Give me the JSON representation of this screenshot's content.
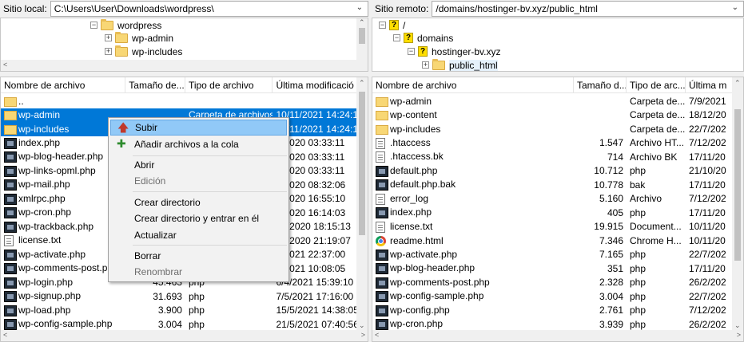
{
  "local": {
    "site_label": "Sitio local:",
    "path": "C:\\Users\\User\\Downloads\\wordpress\\",
    "tree": [
      "wordpress",
      "wp-admin",
      "wp-includes"
    ],
    "columns": [
      "Nombre de archivo",
      "Tamaño de...",
      "Tipo de archivo",
      "Última modificació"
    ],
    "files": [
      {
        "name": "..",
        "icon": "folder-icon",
        "size": "",
        "type": "",
        "mod": ""
      },
      {
        "name": "wp-admin",
        "icon": "folder-icon",
        "size": "",
        "type": "Carpeta de archivos",
        "mod": "10/11/2021 14:24:12",
        "selected": true
      },
      {
        "name": "wp-includes",
        "icon": "folder-icon",
        "size": "",
        "type": "Carpeta de archivos",
        "mod": "10/11/2021 14:24:13",
        "selected": true
      },
      {
        "name": "index.php",
        "icon": "php-icon",
        "size": "",
        "type": "",
        "mod": "2/2020 03:33:11"
      },
      {
        "name": "wp-blog-header.php",
        "icon": "php-icon",
        "size": "",
        "type": "",
        "mod": "2/2020 03:33:11"
      },
      {
        "name": "wp-links-opml.php",
        "icon": "php-icon",
        "size": "",
        "type": "",
        "mod": "2/2020 03:33:11"
      },
      {
        "name": "wp-mail.php",
        "icon": "php-icon",
        "size": "",
        "type": "",
        "mod": "4/2020 08:32:06"
      },
      {
        "name": "xmlrpc.php",
        "icon": "php-icon",
        "size": "",
        "type": "",
        "mod": "6/2020 16:55:10"
      },
      {
        "name": "wp-cron.php",
        "icon": "php-icon",
        "size": "",
        "type": "",
        "mod": "7/2020 16:14:03"
      },
      {
        "name": "wp-trackback.php",
        "icon": "php-icon",
        "size": "",
        "type": "",
        "mod": "10/2020 18:15:13"
      },
      {
        "name": "license.txt",
        "icon": "document-icon",
        "size": "",
        "type": "",
        "mod": "12/2020 21:19:07"
      },
      {
        "name": "wp-activate.php",
        "icon": "php-icon",
        "size": "",
        "type": "",
        "mod": "1/2021 22:37:00"
      },
      {
        "name": "wp-comments-post.php",
        "icon": "php-icon",
        "size": "",
        "type": "",
        "mod": "2/2021 10:08:05"
      },
      {
        "name": "wp-login.php",
        "icon": "php-icon",
        "size": "45.463",
        "type": "php",
        "mod": "6/4/2021 15:39:10"
      },
      {
        "name": "wp-signup.php",
        "icon": "php-icon",
        "size": "31.693",
        "type": "php",
        "mod": "7/5/2021 17:16:00"
      },
      {
        "name": "wp-load.php",
        "icon": "php-icon",
        "size": "3.900",
        "type": "php",
        "mod": "15/5/2021 14:38:05"
      },
      {
        "name": "wp-config-sample.php",
        "icon": "php-icon",
        "size": "3.004",
        "type": "php",
        "mod": "21/5/2021 07:40:56"
      }
    ]
  },
  "remote": {
    "site_label": "Sitio remoto:",
    "path": "/domains/hostinger-bv.xyz/public_html",
    "tree": [
      "/",
      "domains",
      "hostinger-bv.xyz",
      "public_html"
    ],
    "columns": [
      "Nombre de archivo",
      "Tamaño d...",
      "Tipo de arc...",
      "Última m"
    ],
    "files": [
      {
        "name": "wp-admin",
        "icon": "folder-icon",
        "size": "",
        "type": "Carpeta de...",
        "mod": "7/9/2021"
      },
      {
        "name": "wp-content",
        "icon": "folder-icon",
        "size": "",
        "type": "Carpeta de...",
        "mod": "18/12/20"
      },
      {
        "name": "wp-includes",
        "icon": "folder-icon",
        "size": "",
        "type": "Carpeta de...",
        "mod": "22/7/202"
      },
      {
        "name": ".htaccess",
        "icon": "document-icon",
        "size": "1.547",
        "type": "Archivo HT...",
        "mod": "7/12/202"
      },
      {
        "name": ".htaccess.bk",
        "icon": "document-icon",
        "size": "714",
        "type": "Archivo BK",
        "mod": "17/11/20"
      },
      {
        "name": "default.php",
        "icon": "php-icon",
        "size": "10.712",
        "type": "php",
        "mod": "21/10/20"
      },
      {
        "name": "default.php.bak",
        "icon": "php-icon",
        "size": "10.778",
        "type": "bak",
        "mod": "17/11/20"
      },
      {
        "name": "error_log",
        "icon": "document-icon",
        "size": "5.160",
        "type": "Archivo",
        "mod": "7/12/202"
      },
      {
        "name": "index.php",
        "icon": "php-icon",
        "size": "405",
        "type": "php",
        "mod": "17/11/20"
      },
      {
        "name": "license.txt",
        "icon": "document-icon",
        "size": "19.915",
        "type": "Document...",
        "mod": "10/11/20"
      },
      {
        "name": "readme.html",
        "icon": "chrome-icon",
        "size": "7.346",
        "type": "Chrome H...",
        "mod": "10/11/20"
      },
      {
        "name": "wp-activate.php",
        "icon": "php-icon",
        "size": "7.165",
        "type": "php",
        "mod": "22/7/202"
      },
      {
        "name": "wp-blog-header.php",
        "icon": "php-icon",
        "size": "351",
        "type": "php",
        "mod": "17/11/20"
      },
      {
        "name": "wp-comments-post.php",
        "icon": "php-icon",
        "size": "2.328",
        "type": "php",
        "mod": "26/2/202"
      },
      {
        "name": "wp-config-sample.php",
        "icon": "php-icon",
        "size": "3.004",
        "type": "php",
        "mod": "22/7/202"
      },
      {
        "name": "wp-config.php",
        "icon": "php-icon",
        "size": "2.761",
        "type": "php",
        "mod": "7/12/202"
      },
      {
        "name": "wp-cron.php",
        "icon": "php-icon",
        "size": "3.939",
        "type": "php",
        "mod": "26/2/202"
      }
    ]
  },
  "context_menu": {
    "items": [
      {
        "label": "Subir",
        "icon": "upload-arrow-icon",
        "highlighted": true,
        "disabled": false
      },
      {
        "label": "Añadir archivos a la cola",
        "icon": "add-to-queue-icon",
        "highlighted": false,
        "disabled": false
      },
      {
        "label": "Abrir",
        "disabled": false
      },
      {
        "label": "Edición",
        "disabled": true
      },
      {
        "label": "Crear directorio",
        "disabled": false
      },
      {
        "label": "Crear directorio y entrar en él",
        "disabled": false
      },
      {
        "label": "Actualizar",
        "disabled": false
      },
      {
        "label": "Borrar",
        "disabled": false
      },
      {
        "label": "Renombrar",
        "disabled": true
      }
    ]
  },
  "colors": {
    "selection": "#0078d7",
    "menu_highlight": "#91c9f7",
    "upload_arrow": "#c0392b"
  }
}
